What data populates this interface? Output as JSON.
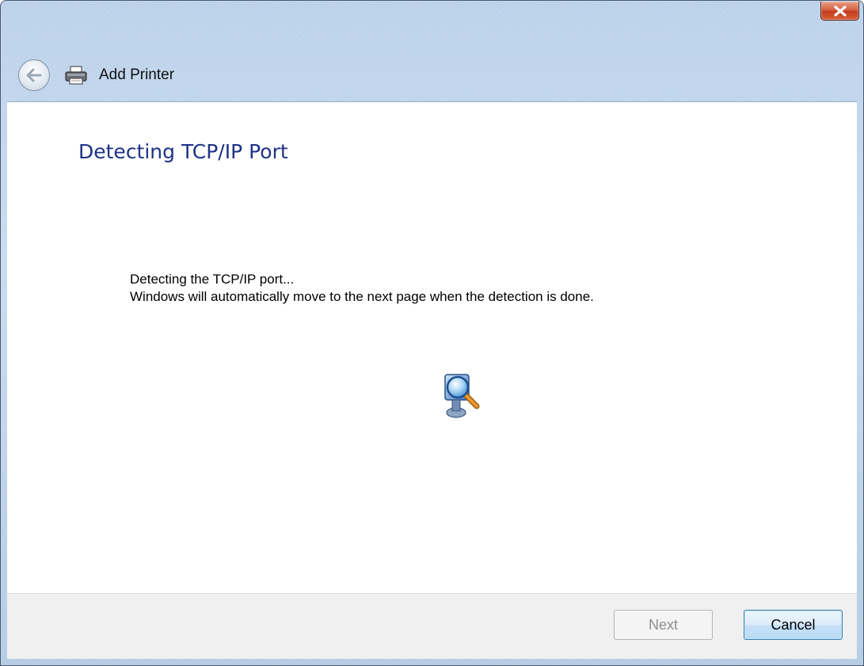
{
  "window": {
    "title": "Add Printer",
    "close_label": "close"
  },
  "page": {
    "heading": "Detecting TCP/IP Port",
    "message_line1": "Detecting the TCP/IP port...",
    "message_line2": "Windows will automatically move to the next page when the detection is done."
  },
  "footer": {
    "next_label": "Next",
    "next_enabled": false,
    "cancel_label": "Cancel"
  },
  "icons": {
    "back": "back-arrow-icon",
    "printer": "printer-icon",
    "close": "close-icon",
    "detecting": "search-computer-icon"
  },
  "colors": {
    "heading": "#1e3287",
    "titlebar": "#bcd2ea",
    "close_button": "#c13b1c",
    "cancel_border": "#3d7bad"
  }
}
